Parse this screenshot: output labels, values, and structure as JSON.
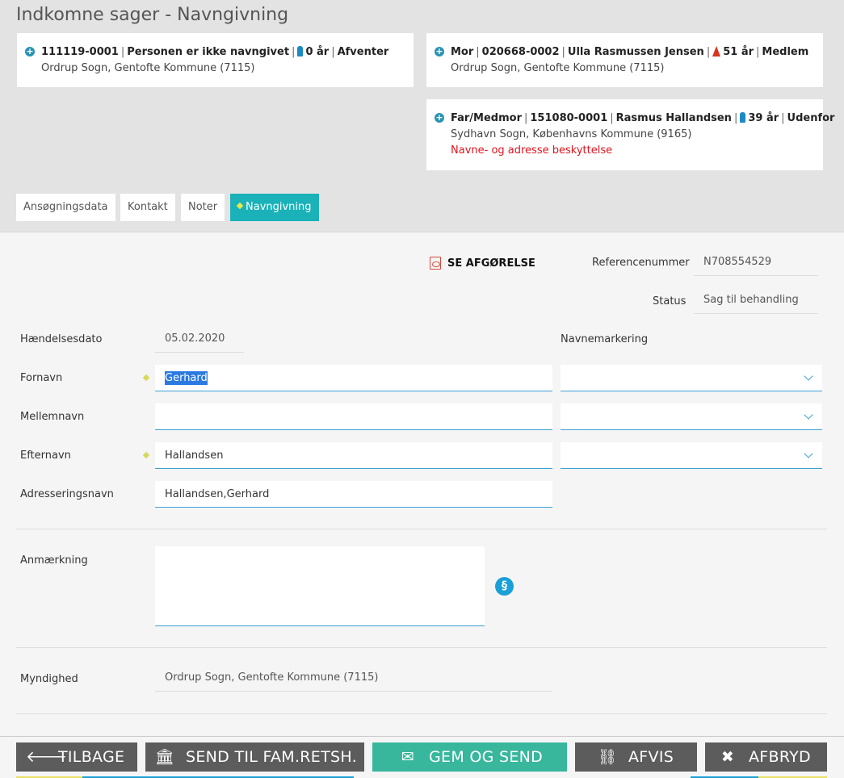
{
  "page_title": "Indkomne sager - Navngivning",
  "cards": {
    "child": {
      "cpr": "111119-0001",
      "name": "Personen er ikke navngivet",
      "age": "0 år",
      "status": "Afventer",
      "address": "Ordrup Sogn, Gentofte Kommune (7115)"
    },
    "mother": {
      "role": "Mor",
      "cpr": "020668-0002",
      "name": "Ulla Rasmussen Jensen",
      "age": "51 år",
      "status": "Medlem",
      "address": "Ordrup Sogn, Gentofte Kommune (7115)"
    },
    "father": {
      "role": "Far/Medmor",
      "cpr": "151080-0001",
      "name": "Rasmus Hallandsen",
      "age": "39 år",
      "status": "Udenfor",
      "address": "Sydhavn Sogn, Københavns Kommune (9165)",
      "warning": "Navne- og adresse beskyttelse"
    }
  },
  "tabs": [
    "Ansøgningsdata",
    "Kontakt",
    "Noter",
    "Navngivning"
  ],
  "pdf_link": "SE AFGØRELSE",
  "form": {
    "reference_label": "Referencenummer",
    "reference_value": "N708554529",
    "status_label": "Status",
    "status_value": "Sag til behandling",
    "event_date_label": "Hændelsesdato",
    "event_date_value": "05.02.2020",
    "name_marking_label": "Navnemarkering",
    "first_name_label": "Fornavn",
    "first_name_value": "Gerhard",
    "middle_name_label": "Mellemnavn",
    "middle_name_value": "",
    "last_name_label": "Efternavn",
    "last_name_value": "Hallandsen",
    "address_name_label": "Adresseringsnavn",
    "address_name_value": "Hallandsen,Gerhard",
    "remark_label": "Anmærkning",
    "remark_value": "",
    "authority_label": "Myndighed",
    "authority_value": "Ordrup Sogn, Gentofte Kommune (7115)"
  },
  "footer": {
    "back": "TILBAGE",
    "send_family": "SEND TIL FAM.RETSH.",
    "save_send": "GEM OG SEND",
    "reject": "AFVIS",
    "cancel": "AFBRYD"
  },
  "colors": {
    "accent": "#1ab2b8",
    "save_button": "#38b79d",
    "dark_button": "#5c5c5c",
    "warning": "#e0141e",
    "input_underline": "#3c9fd6"
  }
}
